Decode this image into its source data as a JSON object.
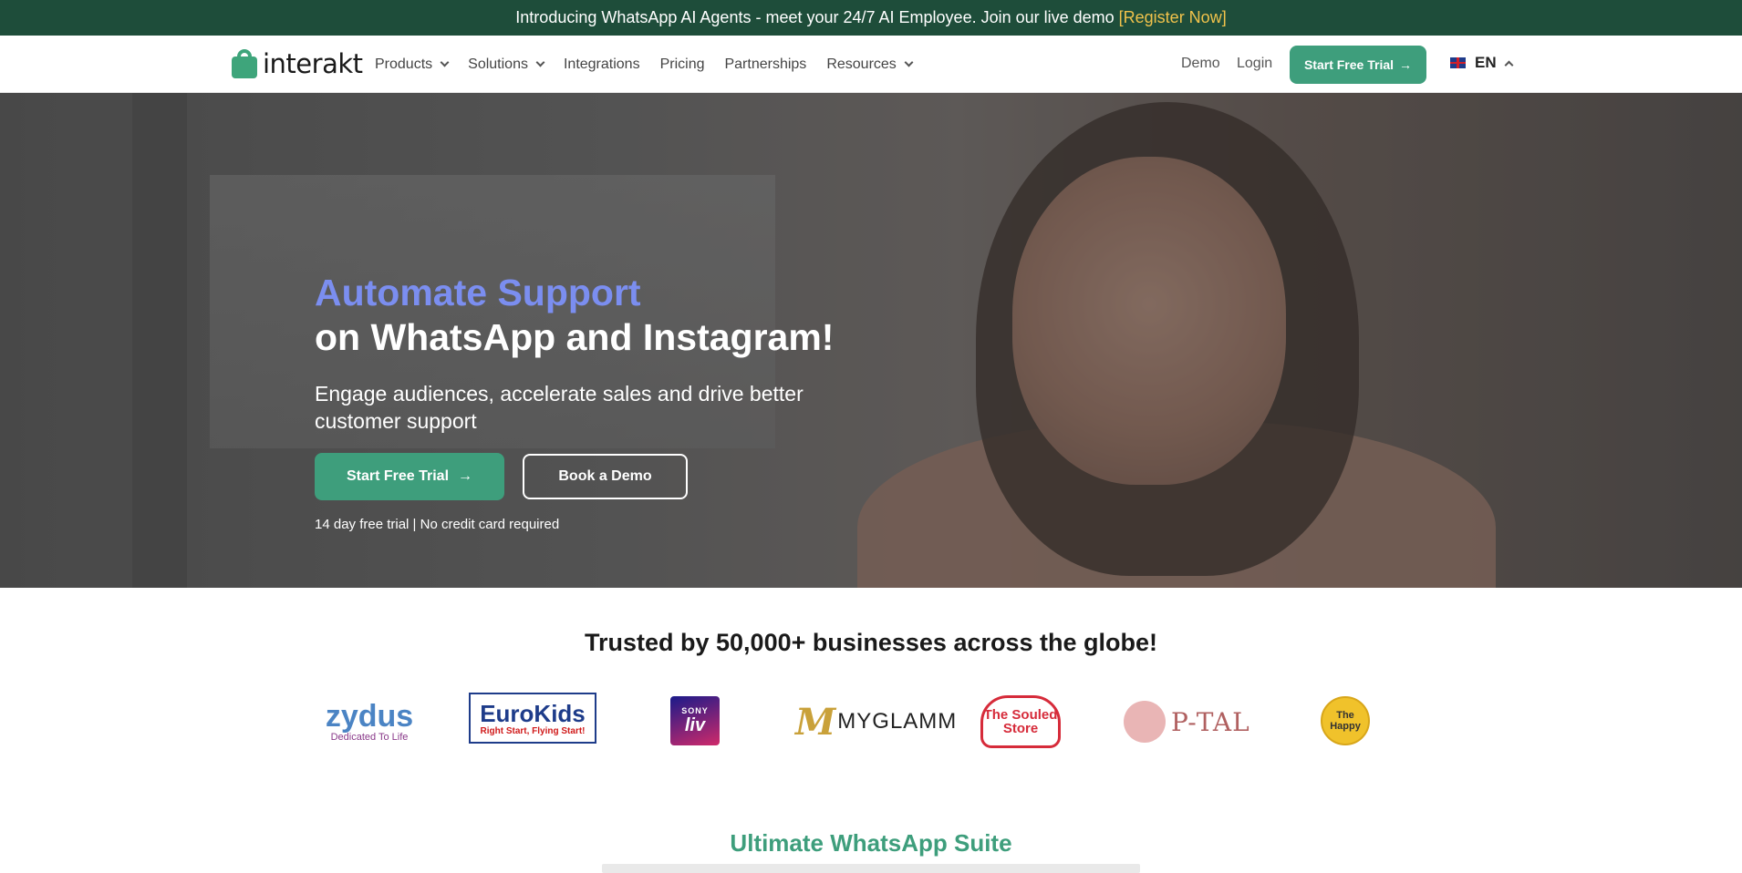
{
  "announcement": {
    "text": "Introducing WhatsApp AI Agents - meet your 24/7 AI Employee. Join our live demo",
    "link": "[Register Now]",
    "link_color": "#f0c24b",
    "background": "#1e4d3a"
  },
  "nav": {
    "logo_text": "interakt",
    "menu": [
      {
        "label": "Products",
        "has_dropdown": true
      },
      {
        "label": "Solutions",
        "has_dropdown": true
      },
      {
        "label": "Integrations",
        "has_dropdown": false
      },
      {
        "label": "Pricing",
        "has_dropdown": false
      },
      {
        "label": "Partnerships",
        "has_dropdown": false
      },
      {
        "label": "Resources",
        "has_dropdown": true
      }
    ],
    "demo": "Demo",
    "login": "Login",
    "cta": "Start Free Trial",
    "language": "EN",
    "accent": "#3e9e7c"
  },
  "hero": {
    "title_highlight": "Automate Support",
    "title_rest": "on WhatsApp and Instagram!",
    "subtitle": "Engage audiences, accelerate sales and drive better customer support",
    "primary_cta": "Start Free Trial",
    "secondary_cta": "Book a Demo",
    "note": "14 day free trial | No credit card required",
    "highlight_color": "#7b8ef0"
  },
  "trusted": {
    "heading": "Trusted by 50,000+ businesses across the globe!",
    "brands": [
      {
        "name": "zydus",
        "tagline": "Dedicated To Life"
      },
      {
        "name": "EuroKids",
        "tagline": "Right Start, Flying Start!"
      },
      {
        "name": "SONY",
        "tagline": "liv"
      },
      {
        "name": "MYGLAMM",
        "mark": "M"
      },
      {
        "name": "The Souled Store"
      },
      {
        "name": "P-TAL"
      },
      {
        "name": "The Happy"
      }
    ]
  },
  "suite": {
    "heading": "Ultimate WhatsApp Suite"
  }
}
